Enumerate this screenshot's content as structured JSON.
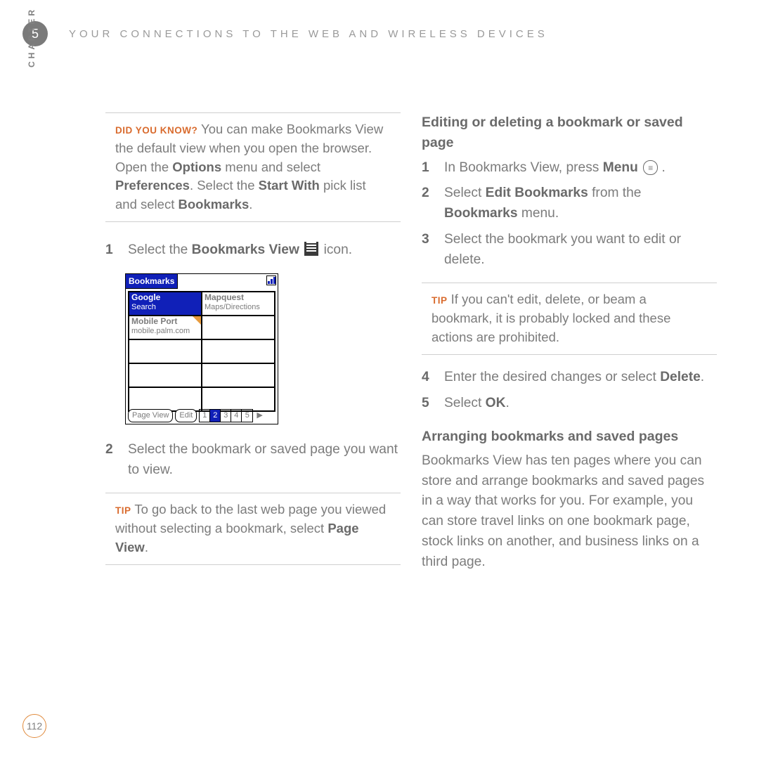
{
  "chapter_number": "5",
  "chapter_label": "CHAPTER",
  "header_title": "YOUR CONNECTIONS TO THE WEB AND WIRELESS DEVICES",
  "page_number": "112",
  "left": {
    "dyk": {
      "label": "DID YOU KNOW?",
      "t1": " You can make Bookmarks View the default view when you open the browser. Open the ",
      "b1": "Options",
      "t2": " menu and select ",
      "b2": "Preferences",
      "t3": ". Select the ",
      "b3": "Start With",
      "t4": " pick list and select ",
      "b4": "Bookmarks",
      "t5": "."
    },
    "step1": {
      "num": "1",
      "pre": "Select the ",
      "bold": "Bookmarks View",
      "post": " icon."
    },
    "step2": {
      "num": "2",
      "text": "Select the bookmark or saved page you want to view."
    },
    "tip": {
      "label": "TIP",
      "t1": " To go back to the last web page you viewed without selecting a bookmark, select ",
      "b1": "Page View",
      "t2": "."
    }
  },
  "right": {
    "heading1": "Editing or deleting a bookmark or saved page",
    "s1": {
      "num": "1",
      "pre": "In Bookmarks View, press ",
      "bold": "Menu",
      "post": " ."
    },
    "s2": {
      "num": "2",
      "pre": "Select ",
      "b1": "Edit Bookmarks",
      "mid": " from the ",
      "b2": "Bookmarks",
      "post": " menu."
    },
    "s3": {
      "num": "3",
      "text": "Select the bookmark you want to edit or delete."
    },
    "tip": {
      "label": "TIP",
      "text": " If you can't edit, delete, or beam a bookmark, it is probably locked and these actions are prohibited."
    },
    "s4": {
      "num": "4",
      "pre": "Enter the desired changes or select ",
      "bold": "Delete",
      "post": "."
    },
    "s5": {
      "num": "5",
      "pre": "Select ",
      "bold": "OK",
      "post": "."
    },
    "heading2": "Arranging bookmarks and saved pages",
    "para": "Bookmarks View has ten pages where you can store and arrange bookmarks and saved pages in a way that works for you. For example, you can store travel links on one bookmark page, stock links on another, and business links on a third page."
  },
  "palm": {
    "title": "Bookmarks",
    "cells": [
      {
        "t1": "Google",
        "t2": "Search",
        "sel": true
      },
      {
        "t1": "Mapquest",
        "t2": "Maps/Directions"
      },
      {
        "t1": "Mobile Port",
        "t2": "mobile.palm.com",
        "dogear": true
      },
      {},
      {},
      {},
      {},
      {},
      {},
      {}
    ],
    "pageview": "Page View",
    "edit": "Edit",
    "pages": [
      "1",
      "2",
      "3",
      "4",
      "5"
    ],
    "active_page": 1,
    "arrow": "▶"
  },
  "menu_glyph": "≡"
}
